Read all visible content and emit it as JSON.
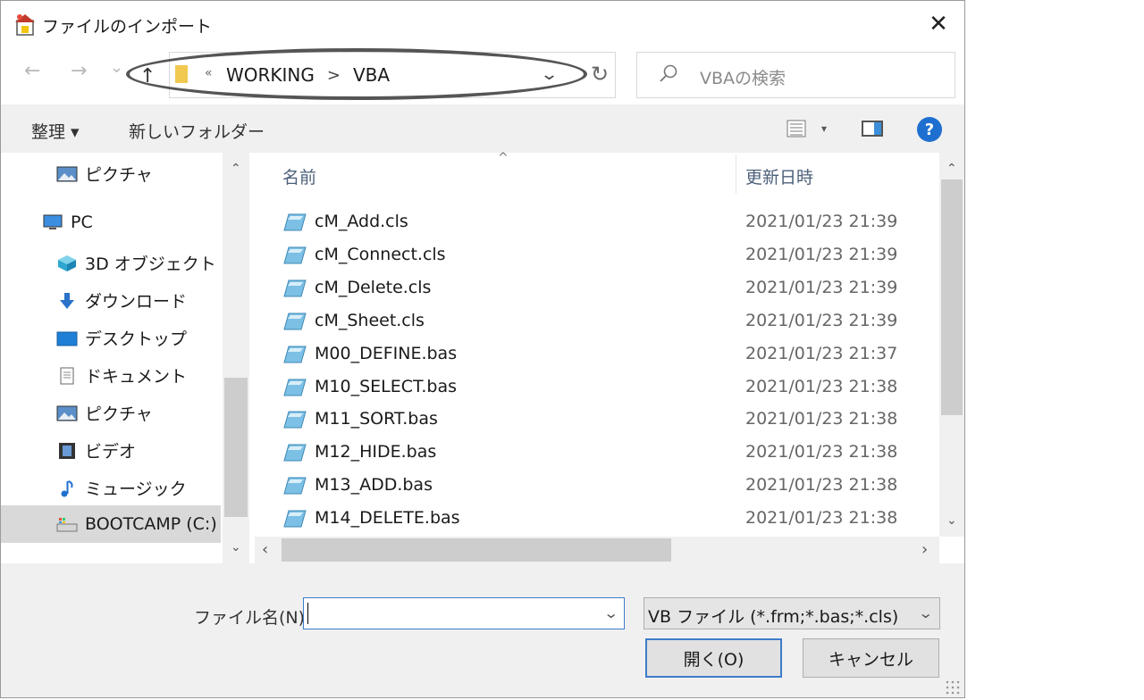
{
  "window": {
    "title": "ファイルのインポート",
    "close_glyph": "✕"
  },
  "nav": {
    "back_glyph": "←",
    "forward_glyph": "→",
    "recent_glyph": "⌄",
    "up_glyph": "↑",
    "refresh_glyph": "↻"
  },
  "address": {
    "overflow_glyph": "«",
    "segments": [
      "WORKING",
      "VBA"
    ],
    "separator": ">",
    "dropdown_glyph": "⌄"
  },
  "search": {
    "placeholder": "VBAの検索"
  },
  "toolbar": {
    "organize": "整理 ▾",
    "new_folder": "新しいフォルダー",
    "view_dropdown": "▾",
    "help": "?"
  },
  "sidebar": {
    "items": [
      {
        "label": "ピクチャ",
        "icon": "pictures-icon"
      },
      {
        "label": "PC",
        "icon": "pc-icon"
      },
      {
        "label": "3D オブジェクト",
        "icon": "3d-objects-icon"
      },
      {
        "label": "ダウンロード",
        "icon": "download-icon"
      },
      {
        "label": "デスクトップ",
        "icon": "desktop-icon"
      },
      {
        "label": "ドキュメント",
        "icon": "documents-icon"
      },
      {
        "label": "ピクチャ",
        "icon": "pictures-icon"
      },
      {
        "label": "ビデオ",
        "icon": "video-icon"
      },
      {
        "label": "ミュージック",
        "icon": "music-icon"
      },
      {
        "label": "BOOTCAMP (C:)",
        "icon": "drive-icon"
      }
    ],
    "selected": "BOOTCAMP (C:)"
  },
  "list": {
    "columns": {
      "name": "名前",
      "date": "更新日時"
    },
    "files": [
      {
        "name": "cM_Add.cls",
        "date": "2021/01/23 21:39"
      },
      {
        "name": "cM_Connect.cls",
        "date": "2021/01/23 21:39"
      },
      {
        "name": "cM_Delete.cls",
        "date": "2021/01/23 21:39"
      },
      {
        "name": "cM_Sheet.cls",
        "date": "2021/01/23 21:39"
      },
      {
        "name": "M00_DEFINE.bas",
        "date": "2021/01/23 21:37"
      },
      {
        "name": "M10_SELECT.bas",
        "date": "2021/01/23 21:38"
      },
      {
        "name": "M11_SORT.bas",
        "date": "2021/01/23 21:38"
      },
      {
        "name": "M12_HIDE.bas",
        "date": "2021/01/23 21:38"
      },
      {
        "name": "M13_ADD.bas",
        "date": "2021/01/23 21:38"
      },
      {
        "name": "M14_DELETE.bas",
        "date": "2021/01/23 21:38"
      }
    ]
  },
  "scroll": {
    "up": "⌃",
    "down": "⌄",
    "left": "‹",
    "right": "›"
  },
  "footer": {
    "filename_label": "ファイル名(N):",
    "filename_value": "",
    "filter_value": "VB ファイル (*.frm;*.bas;*.cls)",
    "open_label": "開く(O)",
    "cancel_label": "キャンセル"
  }
}
